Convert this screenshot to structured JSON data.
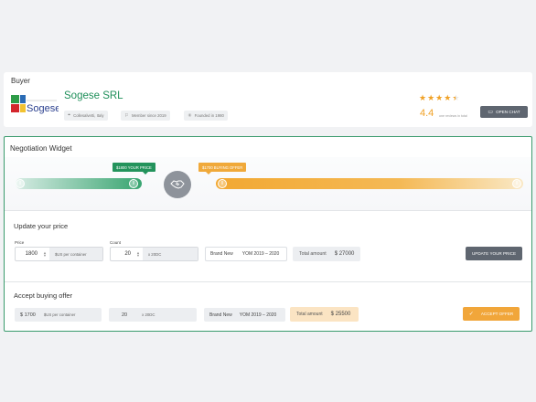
{
  "buyer": {
    "heading": "Buyer",
    "company_name": "Sogese SRL",
    "logo_text": "Sogese",
    "chips": [
      {
        "icon": "map-pin-icon",
        "label": "Collesalvetti, Italy"
      },
      {
        "icon": "flag-icon",
        "label": "Member since 2019"
      },
      {
        "icon": "sparkle-icon",
        "label": "Founded in 1980"
      }
    ],
    "rating_value": "4.4",
    "stars_filled": 4.5,
    "rating_note": "one reviews in total",
    "open_chat_label": "OPEN CHAT",
    "accent_color": "#1f8f5a",
    "star_color": "#f0a126"
  },
  "widget": {
    "title": "Negotiation Widget",
    "your_price_flag": "$1800 YOUR PRICE",
    "buying_offer_flag": "$1700 BUYING OFFER",
    "update_section": {
      "title": "Update your price",
      "price_label": "Price",
      "price_value": "1800",
      "price_unit": "$US per container",
      "count_label": "Count",
      "count_value": "20",
      "count_unit": "x 20DC",
      "condition": "Brand New",
      "yom": "YOM 2019 – 2020",
      "total_label": "Total amount",
      "total_value": "$ 27000",
      "button_label": "UPDATE YOUR PRICE"
    },
    "accept_section": {
      "title": "Accept buying offer",
      "price_value": "$ 1700",
      "price_unit": "$US per container",
      "count_value": "20",
      "count_unit": "x 20DC",
      "condition": "Brand New",
      "yom": "YOM 2019 – 2020",
      "total_label": "Total amount",
      "total_value": "$ 25500",
      "button_label": "ACCEPT OFFER"
    },
    "colors": {
      "green": "#23935c",
      "orange": "#f0a93a",
      "border": "#3a9b6d"
    }
  }
}
